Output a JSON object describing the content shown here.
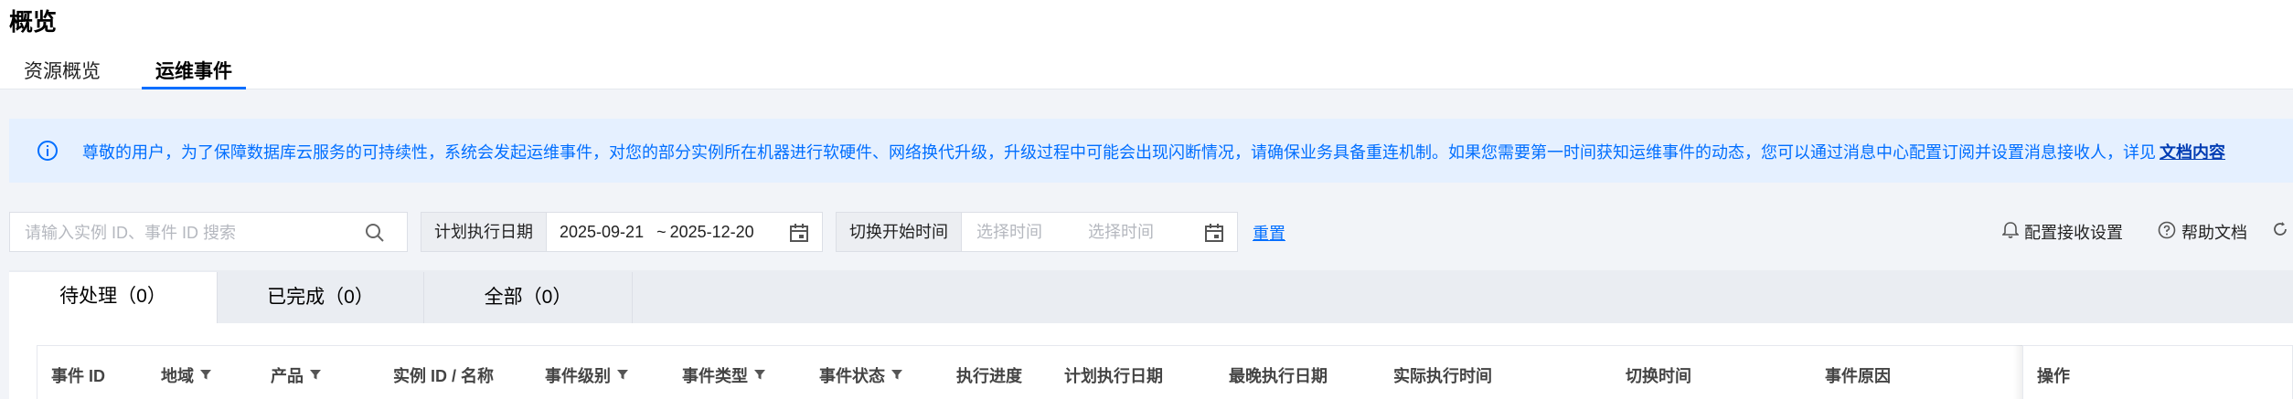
{
  "page": {
    "title": "概览",
    "tabs": [
      {
        "label": "资源概览",
        "active": false
      },
      {
        "label": "运维事件",
        "active": true
      }
    ]
  },
  "notice": {
    "icon": "info-icon",
    "text": "尊敬的用户，为了保障数据库云服务的可持续性，系统会发起运维事件，对您的部分实例所在机器进行软硬件、网络换代升级，升级过程中可能会出现闪断情况，请确保业务具备重连机制。如果您需要第一时间获知运维事件的动态，您可以通过消息中心配置订阅并设置消息接收人，详见",
    "link": "文档内容"
  },
  "filters": {
    "search_placeholder": "请输入实例 ID、事件 ID 搜索",
    "plan_date_label": "计划执行日期",
    "plan_date_start": "2025-09-21",
    "plan_date_sep": "~",
    "plan_date_end": "2025-12-20",
    "switch_label": "切换开始时间",
    "switch_start_ph": "选择时间",
    "switch_end_ph": "选择时间",
    "reset": "重置"
  },
  "toolbar": {
    "receive_settings": "配置接收设置",
    "help_docs": "帮助文档"
  },
  "status_tabs": [
    {
      "label": "待处理（0）",
      "active": true
    },
    {
      "label": "已完成（0）",
      "active": false
    },
    {
      "label": "全部（0）",
      "active": false
    }
  ],
  "table": {
    "columns": [
      {
        "label": "事件 ID",
        "filter": false
      },
      {
        "label": "地域",
        "filter": true
      },
      {
        "label": "产品",
        "filter": true
      },
      {
        "label": "实例 ID / 名称",
        "filter": false
      },
      {
        "label": "事件级别",
        "filter": true
      },
      {
        "label": "事件类型",
        "filter": true
      },
      {
        "label": "事件状态",
        "filter": true
      },
      {
        "label": "执行进度",
        "filter": false
      },
      {
        "label": "计划执行日期",
        "filter": false
      },
      {
        "label": "最晚执行日期",
        "filter": false
      },
      {
        "label": "实际执行时间",
        "filter": false
      },
      {
        "label": "切换时间",
        "filter": false
      },
      {
        "label": "事件原因",
        "filter": false
      },
      {
        "label": "操作",
        "filter": false
      }
    ]
  },
  "colors": {
    "accent": "#006eff",
    "notice_bg": "#e5f0ff",
    "page_bg": "#f2f4f8"
  }
}
